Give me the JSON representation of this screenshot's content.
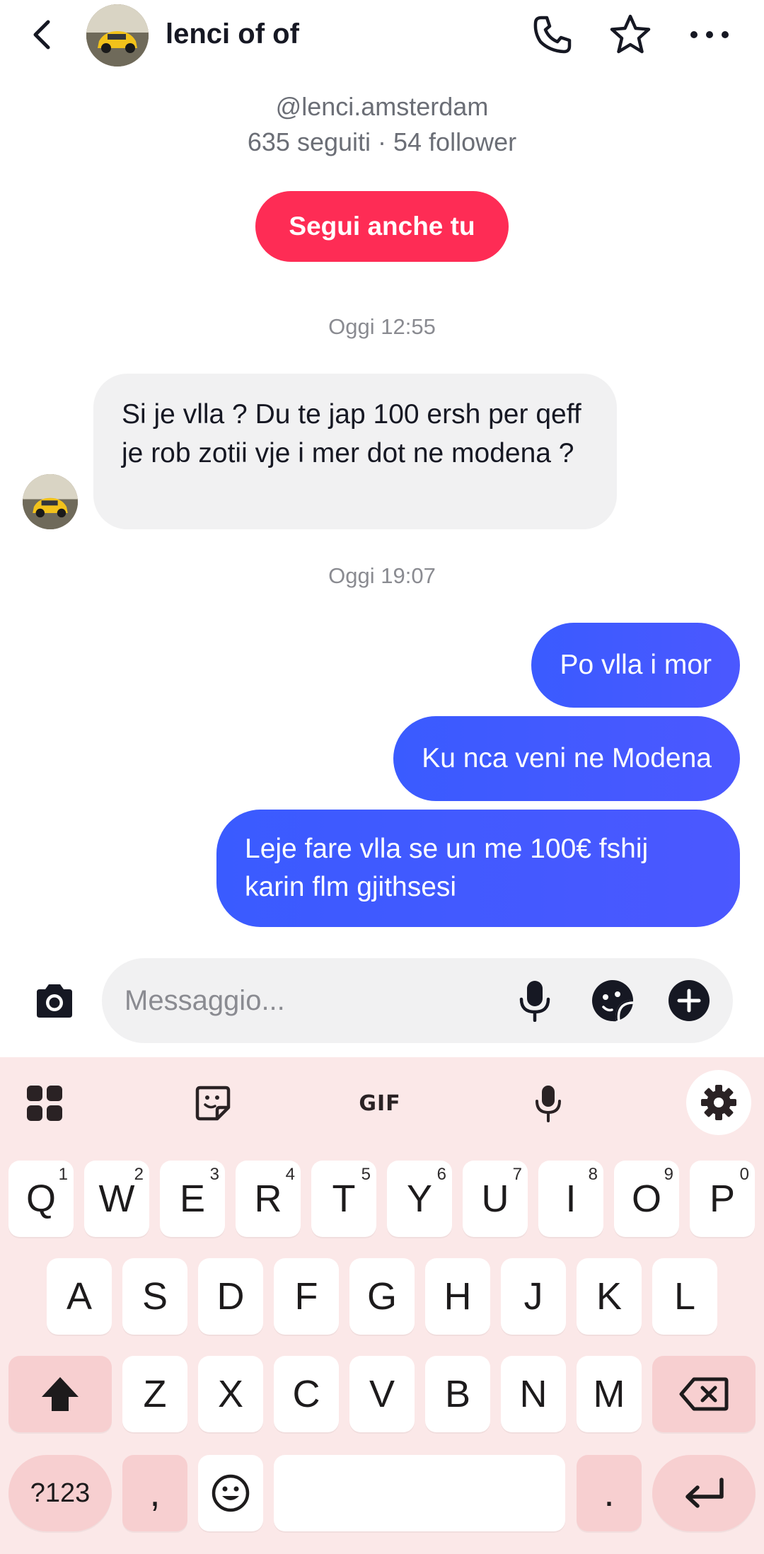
{
  "header": {
    "title": "lenci of of"
  },
  "profile": {
    "handle": "@lenci.amsterdam",
    "stats": "635 seguiti · 54 follower",
    "follow_label": "Segui anche tu"
  },
  "messages": {
    "timestamp_1": "Oggi 12:55",
    "incoming_1": "Si je vlla ? Du te jap 100 ersh per qeff je rob zotii vje i mer dot ne modena ?",
    "timestamp_2": "Oggi 19:07",
    "outgoing": [
      "Po vlla i mor",
      "Ku nca veni ne Modena",
      "Leje fare vlla se un me 100€ fshij karin flm gjithsesi"
    ]
  },
  "composer": {
    "placeholder": "Messaggio..."
  },
  "keyboard": {
    "gif_label": "GIF",
    "row1": [
      {
        "key": "Q",
        "num": "1"
      },
      {
        "key": "W",
        "num": "2"
      },
      {
        "key": "E",
        "num": "3"
      },
      {
        "key": "R",
        "num": "4"
      },
      {
        "key": "T",
        "num": "5"
      },
      {
        "key": "Y",
        "num": "6"
      },
      {
        "key": "U",
        "num": "7"
      },
      {
        "key": "I",
        "num": "8"
      },
      {
        "key": "O",
        "num": "9"
      },
      {
        "key": "P",
        "num": "0"
      }
    ],
    "row2": [
      "A",
      "S",
      "D",
      "F",
      "G",
      "H",
      "J",
      "K",
      "L"
    ],
    "row3": [
      "Z",
      "X",
      "C",
      "V",
      "B",
      "N",
      "M"
    ],
    "sym_label": "?123",
    "comma": ",",
    "period": "."
  },
  "colors": {
    "accent_pink": "#fe2c55",
    "bubble_blue": "#3f5bff",
    "keyboard_bg": "#fbe8e8"
  },
  "icons": {
    "header": [
      "chevron-left-icon",
      "phone-icon",
      "star-icon",
      "more-icon"
    ],
    "composer": [
      "camera-icon",
      "microphone-icon",
      "sticker-icon",
      "plus-circle-icon"
    ],
    "keyboard_toolbar": [
      "apps-grid-icon",
      "sticker-icon",
      "gif-icon",
      "microphone-icon",
      "settings-gear-icon"
    ]
  }
}
